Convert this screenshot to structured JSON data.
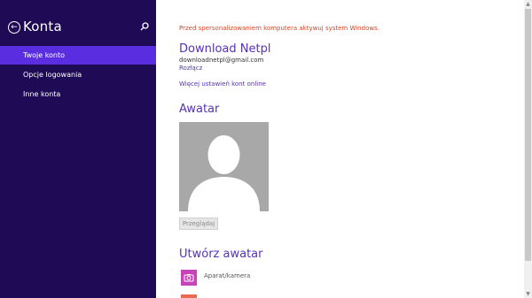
{
  "sidebar": {
    "title": "Konta",
    "back_icon": "arrow-left-icon",
    "search_icon": "search-icon",
    "items": [
      {
        "label": "Twoje konto",
        "active": true
      },
      {
        "label": "Opcje logowania",
        "active": false
      },
      {
        "label": "Inne konta",
        "active": false
      }
    ]
  },
  "main": {
    "warning": "Przed spersonalizowaniem komputera aktywuj system Windows.",
    "account_name": "Download Netpl",
    "email": "downloadnetpl@gmail.com",
    "disconnect_link": "Rozłącz",
    "more_settings_link": "Więcej ustawień kont online",
    "avatar_section_title": "Awatar",
    "browse_button": "Przeglądaj",
    "create_section_title": "Utwórz awatar",
    "create_items": [
      {
        "label": "Aparat/kamera",
        "icon": "camera-icon"
      }
    ]
  },
  "colors": {
    "sidebar_bg": "#1f0a55",
    "nav_active": "#5a2de0",
    "accent": "#5532b8",
    "warning": "#d24726",
    "camera_tile": "#c843b8"
  }
}
